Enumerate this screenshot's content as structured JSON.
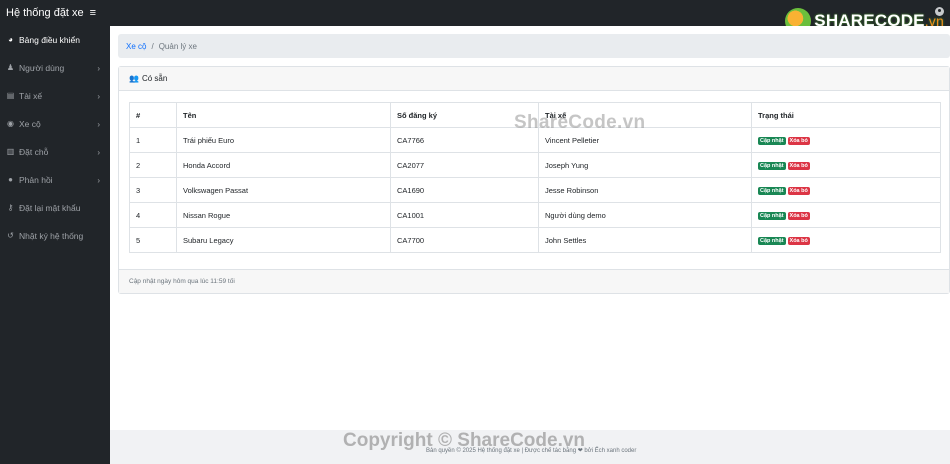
{
  "header": {
    "brand": "Hệ thống đặt xe",
    "menu_icon": "≡"
  },
  "logo": {
    "text": "SHARECODE",
    "suffix": ".vn"
  },
  "sidebar": {
    "items": [
      {
        "label": "Bảng điều khiển",
        "icon": "dashboard-icon",
        "glyph": "◕",
        "chevron": ""
      },
      {
        "label": "Người dùng",
        "icon": "users-icon",
        "glyph": "♟",
        "chevron": "›"
      },
      {
        "label": "Tài xế",
        "icon": "driver-card-icon",
        "glyph": "▤",
        "chevron": "›"
      },
      {
        "label": "Xe cộ",
        "icon": "car-icon",
        "glyph": "◉",
        "chevron": "›"
      },
      {
        "label": "Đặt chỗ",
        "icon": "booking-icon",
        "glyph": "▥",
        "chevron": "›"
      },
      {
        "label": "Phản hồi",
        "icon": "comments-icon",
        "glyph": "●",
        "chevron": "›"
      },
      {
        "label": "Đặt lại mật khẩu",
        "icon": "key-icon",
        "glyph": "⚷",
        "chevron": ""
      },
      {
        "label": "Nhật ký hệ thống",
        "icon": "history-icon",
        "glyph": "↺",
        "chevron": ""
      }
    ]
  },
  "breadcrumb": {
    "link": "Xe cộ",
    "separator": "/",
    "current": "Quản lý xe"
  },
  "card": {
    "title": "Có sẵn",
    "title_icon": "users-icon",
    "footer": "Cập nhật ngày hôm qua lúc 11:59 tối"
  },
  "table": {
    "headers": [
      "#",
      "Tên",
      "Số đăng ký",
      "Tài xế",
      "Trạng thái"
    ],
    "rows": [
      {
        "num": "1",
        "name": "Trái phiếu Euro",
        "reg": "CA7766",
        "driver": "Vincent Pelletier"
      },
      {
        "num": "2",
        "name": "Honda Accord",
        "reg": "CA2077",
        "driver": "Joseph Yung"
      },
      {
        "num": "3",
        "name": "Volkswagen Passat",
        "reg": "CA1690",
        "driver": "Jesse Robinson"
      },
      {
        "num": "4",
        "name": "Nissan Rogue",
        "reg": "CA1001",
        "driver": "Người dùng demo"
      },
      {
        "num": "5",
        "name": "Subaru Legacy",
        "reg": "CA7700",
        "driver": "John Settles"
      }
    ],
    "update_label": "Cập nhật",
    "delete_label": "Xóa bỏ"
  },
  "watermark": "ShareCode.vn",
  "footer": {
    "text": "Bản quyền © 2025 Hệ thống đặt xe | Được chế tác bằng ❤ bởi Ếch xanh coder",
    "copyright_watermark": "Copyright © ShareCode.vn"
  },
  "colors": {
    "sidebar": "#212529",
    "update": "#198754",
    "delete": "#dc3545",
    "link": "#0d6efd"
  }
}
